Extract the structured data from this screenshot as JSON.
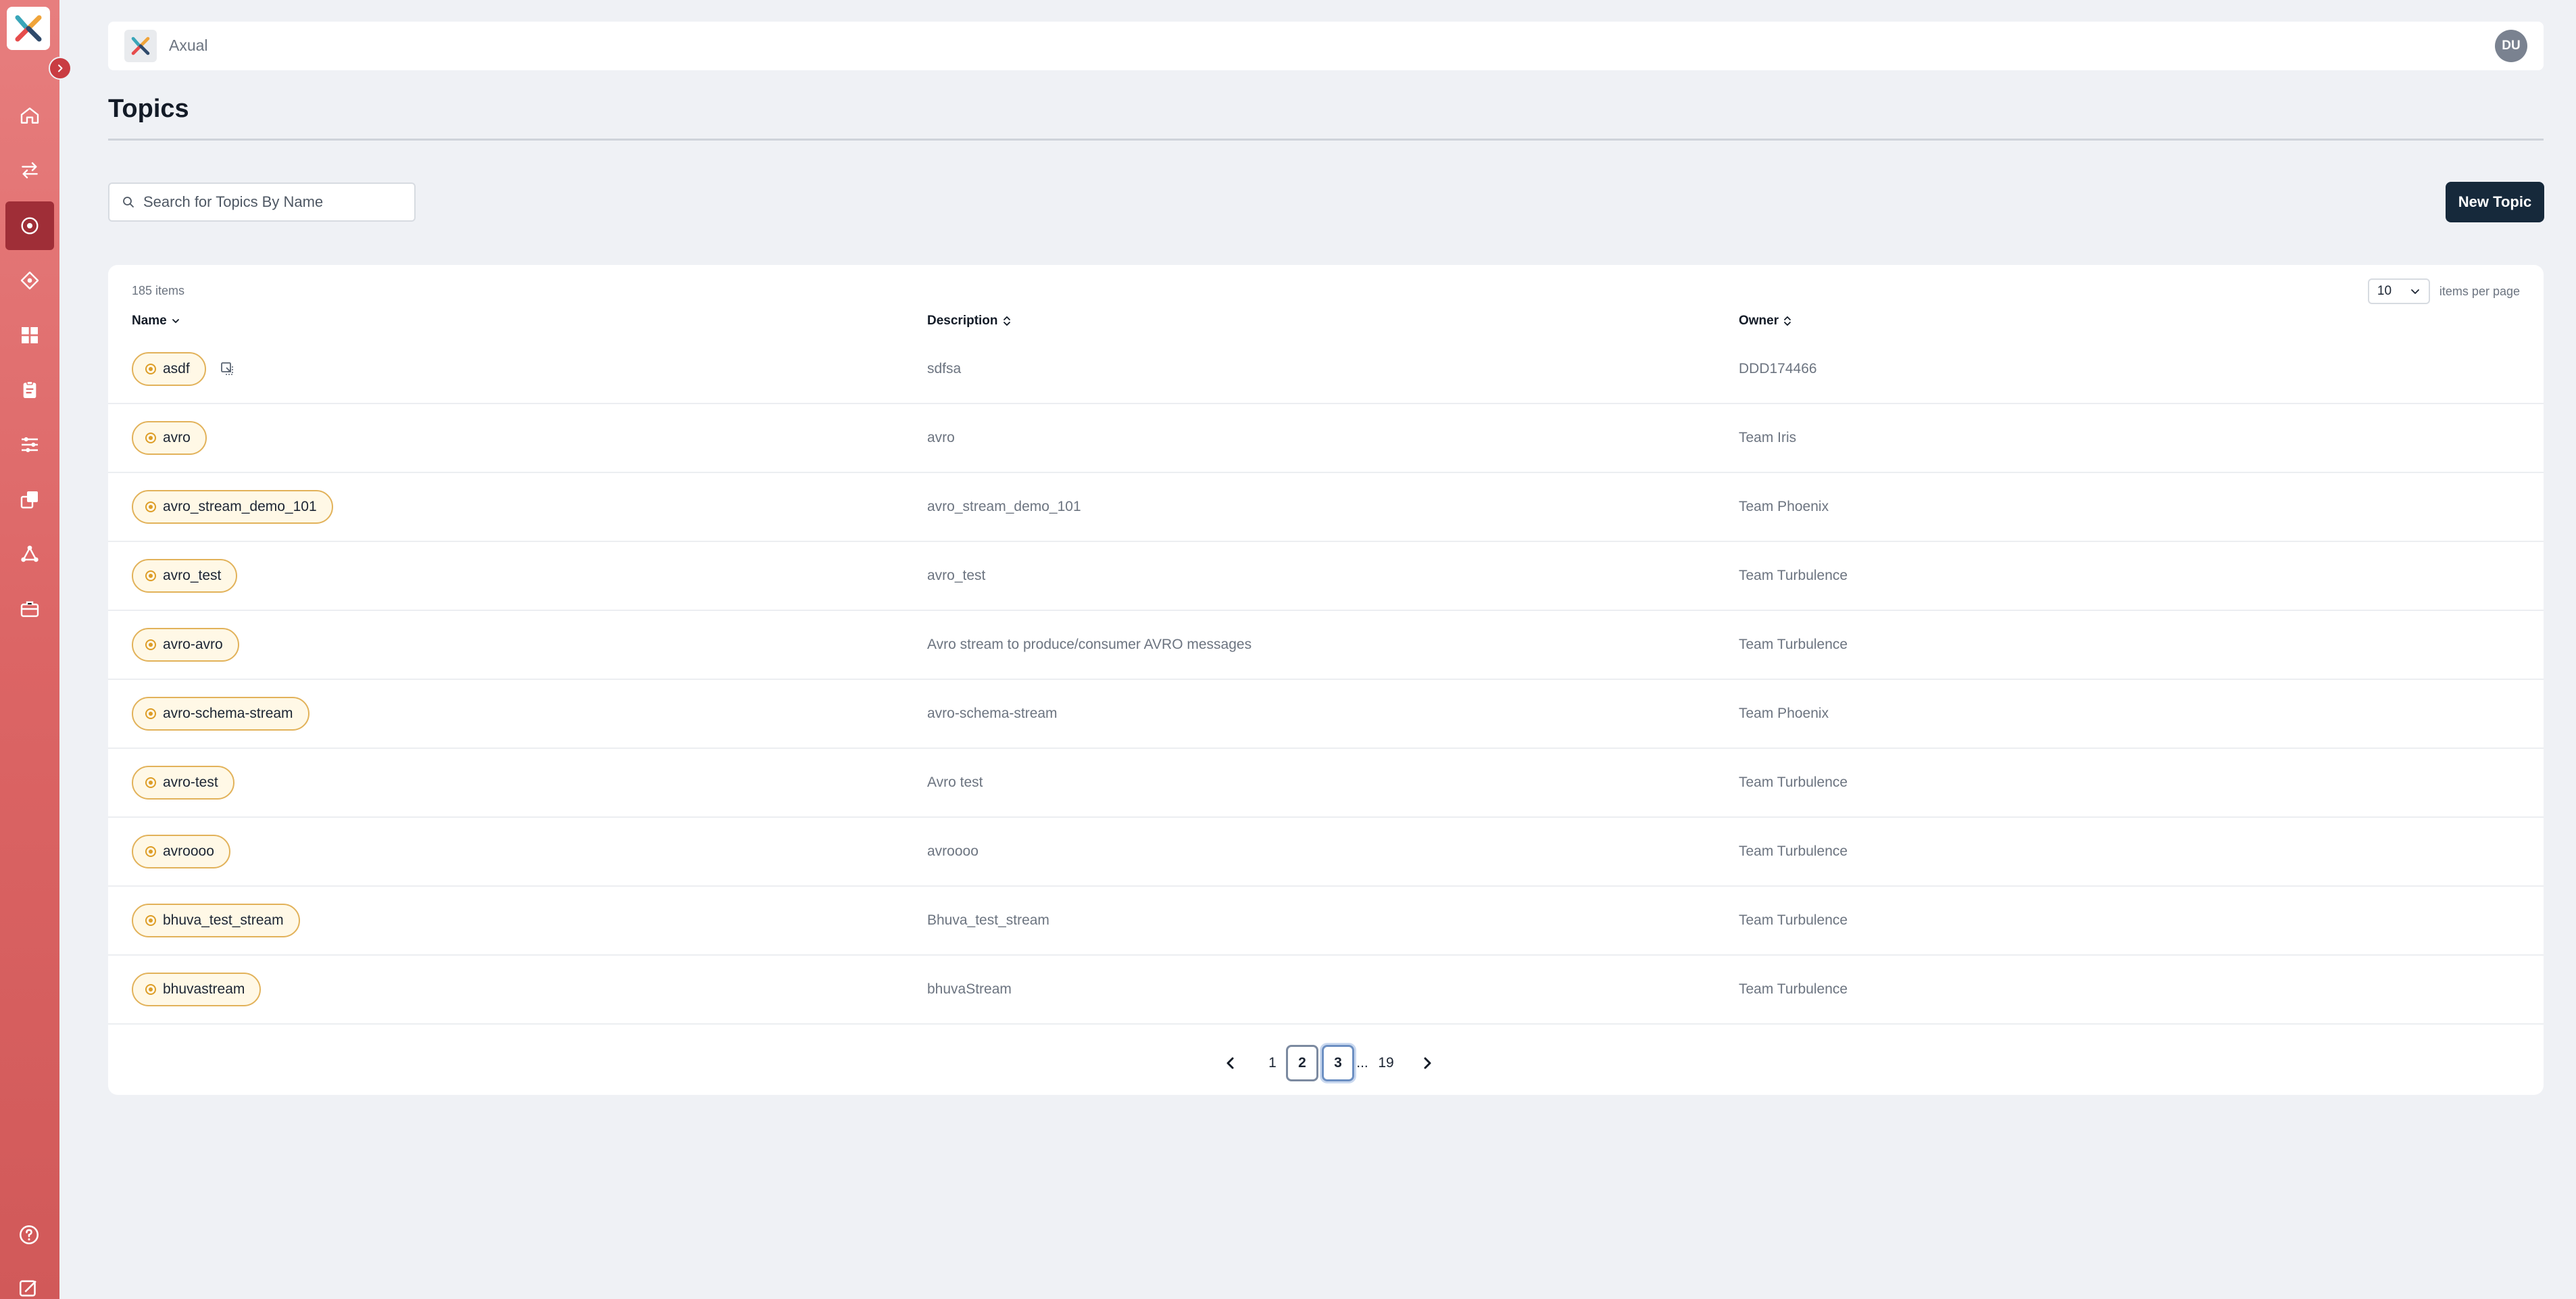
{
  "app": {
    "name": "Axual",
    "user_initials": "DU"
  },
  "colors": {
    "sidebar": "#dc6565",
    "sidebar_active": "#9f2e37",
    "primary_button": "#16293b",
    "pill_bg": "#fff8e6",
    "pill_border": "#e2b25a"
  },
  "sidebar": {
    "items": [
      {
        "icon": "home-icon"
      },
      {
        "icon": "transfer-icon"
      },
      {
        "icon": "topic-icon",
        "active": true
      },
      {
        "icon": "application-icon"
      },
      {
        "icon": "dashboard-icon"
      },
      {
        "icon": "clipboard-icon"
      },
      {
        "icon": "sliders-icon"
      },
      {
        "icon": "copy-stack-icon"
      },
      {
        "icon": "network-icon"
      },
      {
        "icon": "toolbox-icon"
      }
    ],
    "bottom_items": [
      {
        "icon": "help-icon"
      },
      {
        "icon": "feedback-icon"
      }
    ]
  },
  "page": {
    "title": "Topics"
  },
  "search": {
    "placeholder": "Search for Topics By Name",
    "value": ""
  },
  "actions": {
    "new_topic_label": "New Topic"
  },
  "table": {
    "items_count": "185 items",
    "per_page_value": "10",
    "per_page_label": "items per page",
    "columns": {
      "name": "Name",
      "description": "Description",
      "owner": "Owner"
    },
    "rows": [
      {
        "name": "asdf",
        "description": "sdfsa",
        "owner": "DDD174466"
      },
      {
        "name": "avro",
        "description": "avro",
        "owner": "Team Iris"
      },
      {
        "name": "avro_stream_demo_101",
        "description": "avro_stream_demo_101",
        "owner": "Team Phoenix"
      },
      {
        "name": "avro_test",
        "description": "avro_test",
        "owner": "Team Turbulence"
      },
      {
        "name": "avro-avro",
        "description": "Avro stream to produce/consumer AVRO messages",
        "owner": "Team Turbulence"
      },
      {
        "name": "avro-schema-stream",
        "description": "avro-schema-stream",
        "owner": "Team Phoenix"
      },
      {
        "name": "avro-test",
        "description": "Avro test",
        "owner": "Team Turbulence"
      },
      {
        "name": "avroooo",
        "description": "avroooo",
        "owner": "Team Turbulence"
      },
      {
        "name": "bhuva_test_stream",
        "description": "Bhuva_test_stream",
        "owner": "Team Turbulence"
      },
      {
        "name": "bhuvastream",
        "description": "bhuvaStream",
        "owner": "Team Turbulence"
      }
    ]
  },
  "pagination": {
    "p1": "1",
    "p2": "2",
    "p3": "3",
    "ellipsis": "...",
    "last": "19"
  }
}
